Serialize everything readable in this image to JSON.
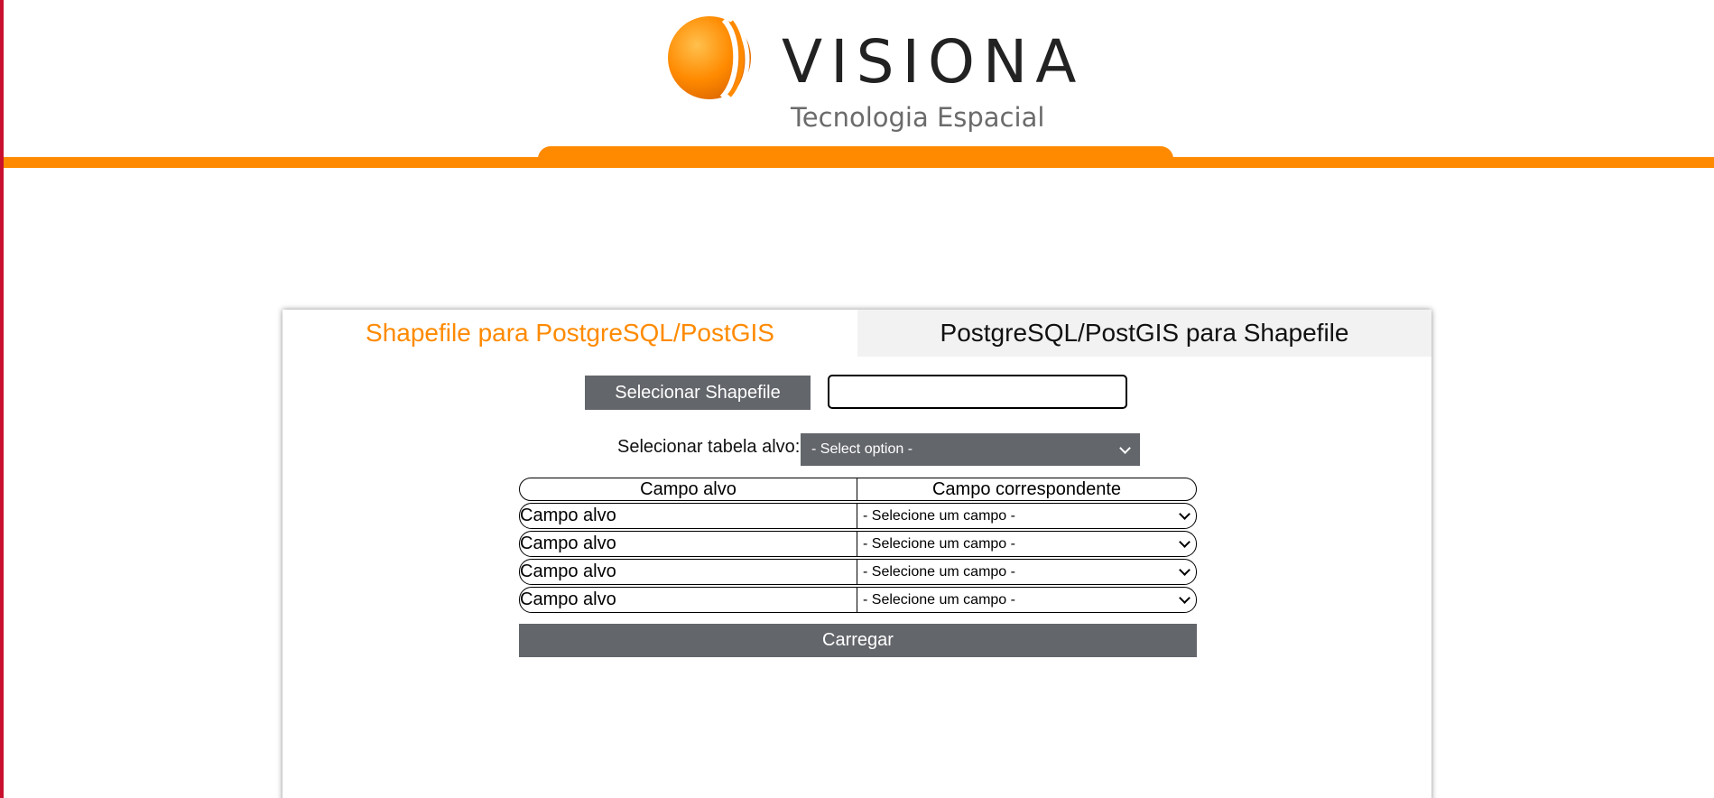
{
  "brand": {
    "name": "VISIONA",
    "tagline": "Tecnologia Espacial",
    "accent_color": "#ff8a00",
    "edge_color": "#c8102e"
  },
  "tabs": [
    {
      "label": "Shapefile para PostgreSQL/PostGIS",
      "active": true
    },
    {
      "label": "PostgreSQL/PostGIS para Shapefile",
      "active": false
    }
  ],
  "form": {
    "select_shapefile_label": "Selecionar Shapefile",
    "file_input_value": "",
    "target_table_label": "Selecionar tabela alvo:",
    "target_table_selected": "- Select option -"
  },
  "mapping_table": {
    "headers": [
      "Campo alvo",
      "Campo correspondente"
    ],
    "rows": [
      {
        "target": "Campo alvo",
        "match": "- Selecione um campo -"
      },
      {
        "target": "Campo alvo",
        "match": "- Selecione um campo -"
      },
      {
        "target": "Campo alvo",
        "match": "- Selecione um campo -"
      },
      {
        "target": "Campo alvo",
        "match": "- Selecione um campo -"
      }
    ]
  },
  "load_button_label": "Carregar",
  "icons": {
    "logo": "visiona-logo-icon",
    "dropdown": "chevron-down-icon"
  }
}
